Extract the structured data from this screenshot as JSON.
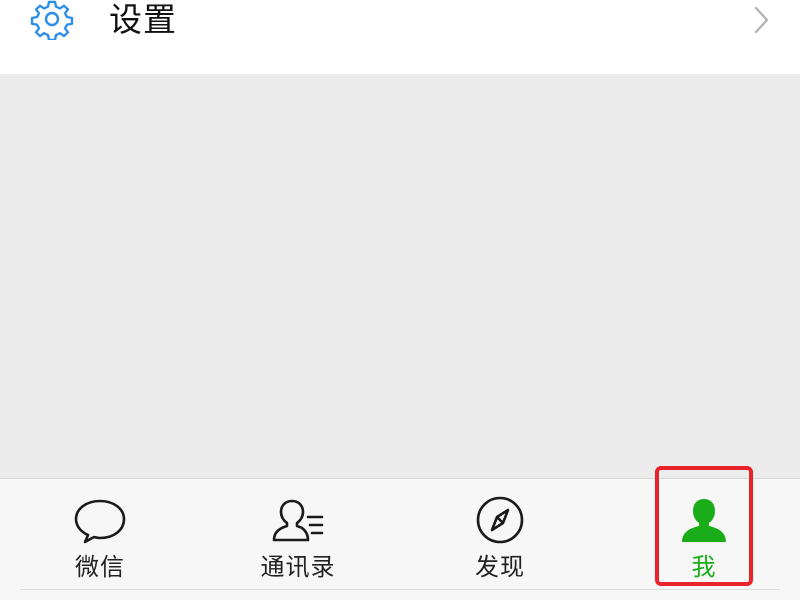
{
  "settings": {
    "label": "设置",
    "icon": "gear-icon"
  },
  "tabbar": {
    "active_color": "#1aad19",
    "tabs": [
      {
        "label": "微信",
        "icon": "chat-bubble-icon"
      },
      {
        "label": "通讯录",
        "icon": "contacts-icon"
      },
      {
        "label": "发现",
        "icon": "compass-icon"
      },
      {
        "label": "我",
        "icon": "person-icon",
        "active": true
      }
    ]
  },
  "annotation": {
    "highlight_color": "#e8232b",
    "highlighted": "tab-me"
  }
}
